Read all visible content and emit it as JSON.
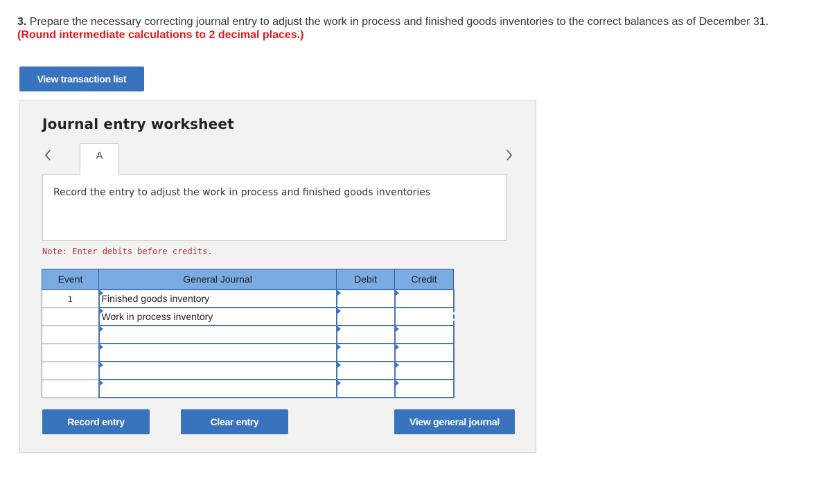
{
  "question": {
    "number": "3.",
    "text": "Prepare the necessary correcting journal entry to adjust the work in process and finished goods inventories to the correct balances as of December 31.",
    "rounding_note": "(Round intermediate calculations to 2 decimal places.)"
  },
  "buttons": {
    "view_transaction_list": "View transaction list",
    "record_entry": "Record entry",
    "clear_entry": "Clear entry",
    "view_general_journal": "View general journal"
  },
  "worksheet": {
    "title": "Journal entry worksheet",
    "active_tab": "A",
    "description": "Record the entry to adjust the work in process and finished goods inventories",
    "note": "Note: Enter debits before credits.",
    "columns": [
      "Event",
      "General Journal",
      "Debit",
      "Credit"
    ],
    "rows": [
      {
        "event": "1",
        "account": "Finished goods inventory",
        "debit": "",
        "credit": ""
      },
      {
        "event": "",
        "account": "Work in process inventory",
        "debit": "",
        "credit": ""
      },
      {
        "event": "",
        "account": "",
        "debit": "",
        "credit": ""
      },
      {
        "event": "",
        "account": "",
        "debit": "",
        "credit": ""
      },
      {
        "event": "",
        "account": "",
        "debit": "",
        "credit": ""
      },
      {
        "event": "",
        "account": "",
        "debit": "",
        "credit": ""
      }
    ]
  },
  "colors": {
    "button_blue": "#3a73bd",
    "header_blue": "#7aabe3",
    "rounding_red": "#e0191d",
    "note_red": "#b5302d"
  },
  "icons": {
    "prev": "chevron-left-icon",
    "next": "chevron-right-icon"
  }
}
